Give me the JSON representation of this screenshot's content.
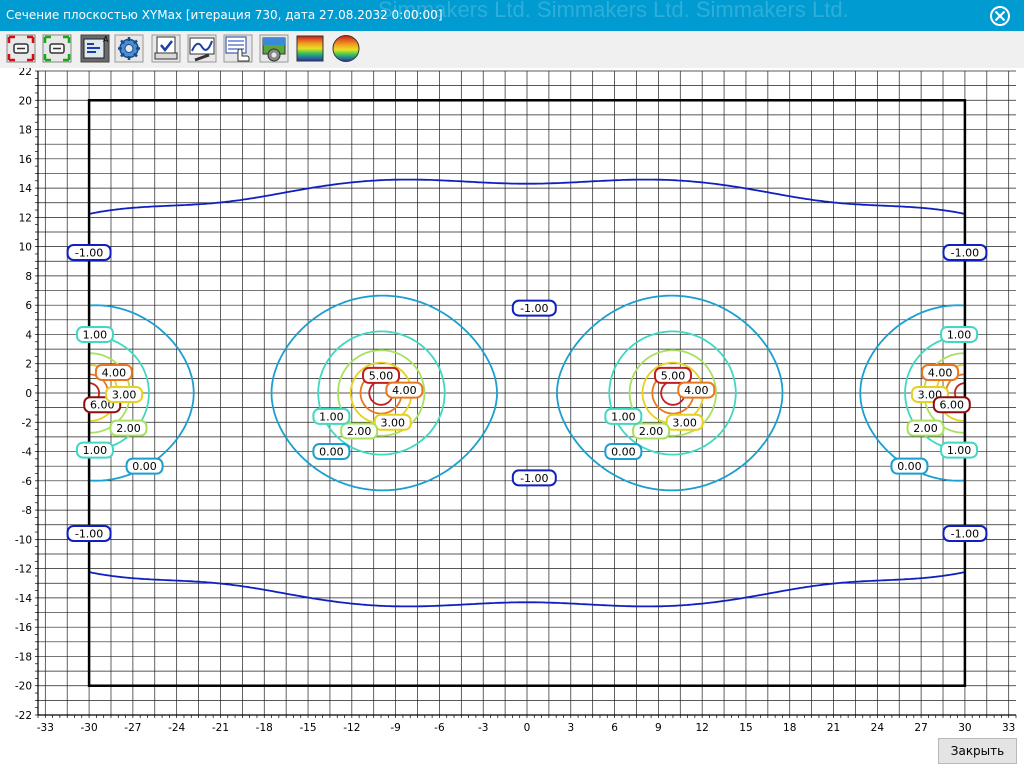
{
  "window": {
    "title": "Сечение плоскостью XYMax [итерация 730, дата 27.08.2032 0:00:00]",
    "watermark": "Simmakers Ltd.  Simmakers Ltd.      Simmakers Ltd.",
    "close_icon": "close-icon"
  },
  "toolbar": {
    "buttons": [
      {
        "name": "frame-red-button",
        "icon": "frame-red-icon"
      },
      {
        "name": "frame-green-button",
        "icon": "frame-green-icon"
      },
      {
        "name": "legend-button",
        "icon": "legend-icon"
      },
      {
        "name": "settings-button",
        "icon": "gear-icon"
      },
      {
        "name": "export-button",
        "icon": "export-icon"
      },
      {
        "name": "graph-tools-button",
        "icon": "chart-wrench-icon"
      },
      {
        "name": "table-select-button",
        "icon": "table-hand-icon"
      },
      {
        "name": "image-settings-button",
        "icon": "image-gear-icon"
      },
      {
        "name": "color-palette-button",
        "icon": "palette-icon"
      },
      {
        "name": "color-scheme-button",
        "icon": "color-circle-icon"
      }
    ]
  },
  "footer": {
    "close_label": "Закрыть"
  },
  "chart_data": {
    "type": "contour",
    "x_ticks": [
      -33,
      -30,
      -27,
      -24,
      -21,
      -18,
      -15,
      -12,
      -9,
      -6,
      -3,
      0,
      3,
      6,
      9,
      12,
      15,
      18,
      21,
      24,
      27,
      30,
      33
    ],
    "y_ticks": [
      22,
      20,
      18,
      16,
      14,
      12,
      10,
      8,
      6,
      4,
      2,
      0,
      -2,
      -4,
      -6,
      -8,
      -10,
      -12,
      -14,
      -16,
      -18,
      -20,
      -22
    ],
    "xlim": [
      -33.5,
      33.5
    ],
    "ylim": [
      -22,
      22
    ],
    "grid": true,
    "domain_rect": {
      "x": [
        -30,
        30
      ],
      "y": [
        -20,
        20
      ]
    },
    "sources": [
      -30,
      -10,
      10,
      30
    ],
    "levels": [
      {
        "value": -1.0,
        "color": "#1020c0",
        "dashed": false,
        "label": "-1.00"
      },
      {
        "value": 0.0,
        "color": "#1a9fd0",
        "dashed": true,
        "label": "0.00"
      },
      {
        "value": 1.0,
        "color": "#40d8c0",
        "dashed": false,
        "label": "1.00"
      },
      {
        "value": 2.0,
        "color": "#a8e060",
        "dashed": false,
        "label": "2.00"
      },
      {
        "value": 3.0,
        "color": "#e8d020",
        "dashed": false,
        "label": "3.00"
      },
      {
        "value": 4.0,
        "color": "#e87820",
        "dashed": false,
        "label": "4.00"
      },
      {
        "value": 5.0,
        "color": "#c02020",
        "dashed": false,
        "label": "5.00"
      },
      {
        "value": 6.0,
        "color": "#8a1010",
        "dashed": false,
        "label": "6.00"
      }
    ],
    "level_labels": [
      {
        "text": "-1.00",
        "x": -30,
        "y": 9.6
      },
      {
        "text": "-1.00",
        "x": 30,
        "y": 9.6
      },
      {
        "text": "-1.00",
        "x": 0.5,
        "y": 5.8
      },
      {
        "text": "-1.00",
        "x": 0.5,
        "y": -5.8
      },
      {
        "text": "-1.00",
        "x": -30,
        "y": -9.6
      },
      {
        "text": "-1.00",
        "x": 30,
        "y": -9.6
      },
      {
        "text": "1.00",
        "x": -29.6,
        "y": 4.0
      },
      {
        "text": "1.00",
        "x": -29.6,
        "y": -3.9
      },
      {
        "text": "4.00",
        "x": -28.3,
        "y": 1.4
      },
      {
        "text": "6.00",
        "x": -29.1,
        "y": -0.8
      },
      {
        "text": "3.00",
        "x": -27.6,
        "y": -0.1
      },
      {
        "text": "2.00",
        "x": -27.3,
        "y": -2.4
      },
      {
        "text": "0.00",
        "x": -26.2,
        "y": -5.0
      },
      {
        "text": "5.00",
        "x": -10.0,
        "y": 1.2
      },
      {
        "text": "4.00",
        "x": -8.4,
        "y": 0.2
      },
      {
        "text": "3.00",
        "x": -9.2,
        "y": -2.0
      },
      {
        "text": "2.00",
        "x": -11.5,
        "y": -2.6
      },
      {
        "text": "1.00",
        "x": -13.4,
        "y": -1.6
      },
      {
        "text": "0.00",
        "x": -13.4,
        "y": -4.0
      },
      {
        "text": "5.00",
        "x": 10.0,
        "y": 1.2
      },
      {
        "text": "4.00",
        "x": 11.6,
        "y": 0.2
      },
      {
        "text": "3.00",
        "x": 10.8,
        "y": -2.0
      },
      {
        "text": "2.00",
        "x": 8.5,
        "y": -2.6
      },
      {
        "text": "1.00",
        "x": 6.6,
        "y": -1.6
      },
      {
        "text": "0.00",
        "x": 6.6,
        "y": -4.0
      },
      {
        "text": "4.00",
        "x": 28.3,
        "y": 1.4
      },
      {
        "text": "3.00",
        "x": 27.6,
        "y": -0.1
      },
      {
        "text": "6.00",
        "x": 29.1,
        "y": -0.8
      },
      {
        "text": "2.00",
        "x": 27.3,
        "y": -2.4
      },
      {
        "text": "1.00",
        "x": 29.6,
        "y": 4.0
      },
      {
        "text": "1.00",
        "x": 29.6,
        "y": -3.9
      },
      {
        "text": "0.00",
        "x": 26.2,
        "y": -5.0
      }
    ]
  }
}
